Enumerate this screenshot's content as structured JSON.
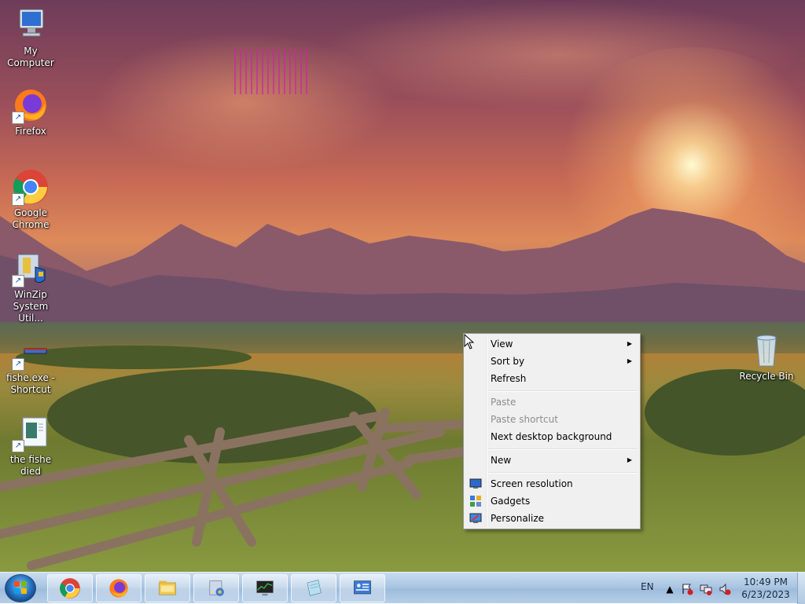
{
  "desktop": {
    "icons": [
      {
        "label": "My Computer",
        "icon": "computer-icon"
      },
      {
        "label": "Firefox",
        "icon": "firefox-icon"
      },
      {
        "label": "Google Chrome",
        "icon": "chrome-icon"
      },
      {
        "label": "WinZip System Util...",
        "icon": "winzip-icon"
      },
      {
        "label": "fishe.exe - Shortcut",
        "icon": "exe-icon"
      },
      {
        "label": "the fishe died",
        "icon": "text-document-icon"
      },
      {
        "label": "Recycle Bin",
        "icon": "recycle-bin-icon"
      }
    ]
  },
  "context_menu": {
    "items": [
      {
        "label": "View",
        "submenu": true,
        "enabled": true
      },
      {
        "label": "Sort by",
        "submenu": true,
        "enabled": true
      },
      {
        "label": "Refresh",
        "submenu": false,
        "enabled": true
      },
      {
        "label": "Paste",
        "submenu": false,
        "enabled": false
      },
      {
        "label": "Paste shortcut",
        "submenu": false,
        "enabled": false
      },
      {
        "label": "Next desktop background",
        "submenu": false,
        "enabled": true
      },
      {
        "label": "New",
        "submenu": true,
        "enabled": true
      },
      {
        "label": "Screen resolution",
        "submenu": false,
        "enabled": true,
        "icon": "screen-resolution-icon"
      },
      {
        "label": "Gadgets",
        "submenu": false,
        "enabled": true,
        "icon": "gadgets-icon"
      },
      {
        "label": "Personalize",
        "submenu": false,
        "enabled": true,
        "icon": "personalize-icon"
      }
    ]
  },
  "taskbar": {
    "pinned": [
      {
        "icon": "chrome-icon"
      },
      {
        "icon": "firefox-icon"
      },
      {
        "icon": "file-explorer-icon"
      },
      {
        "icon": "control-panel-icon"
      },
      {
        "icon": "task-manager-icon"
      },
      {
        "icon": "notepad-icon"
      },
      {
        "icon": "network-monitor-icon"
      }
    ],
    "language": "EN",
    "clock_time": "10:49 PM",
    "clock_date": "6/23/2023"
  },
  "colors": {
    "menu_bg": "#f0f0f0",
    "taskbar": "#aac6e3",
    "disabled_text": "#8d8d8d"
  }
}
